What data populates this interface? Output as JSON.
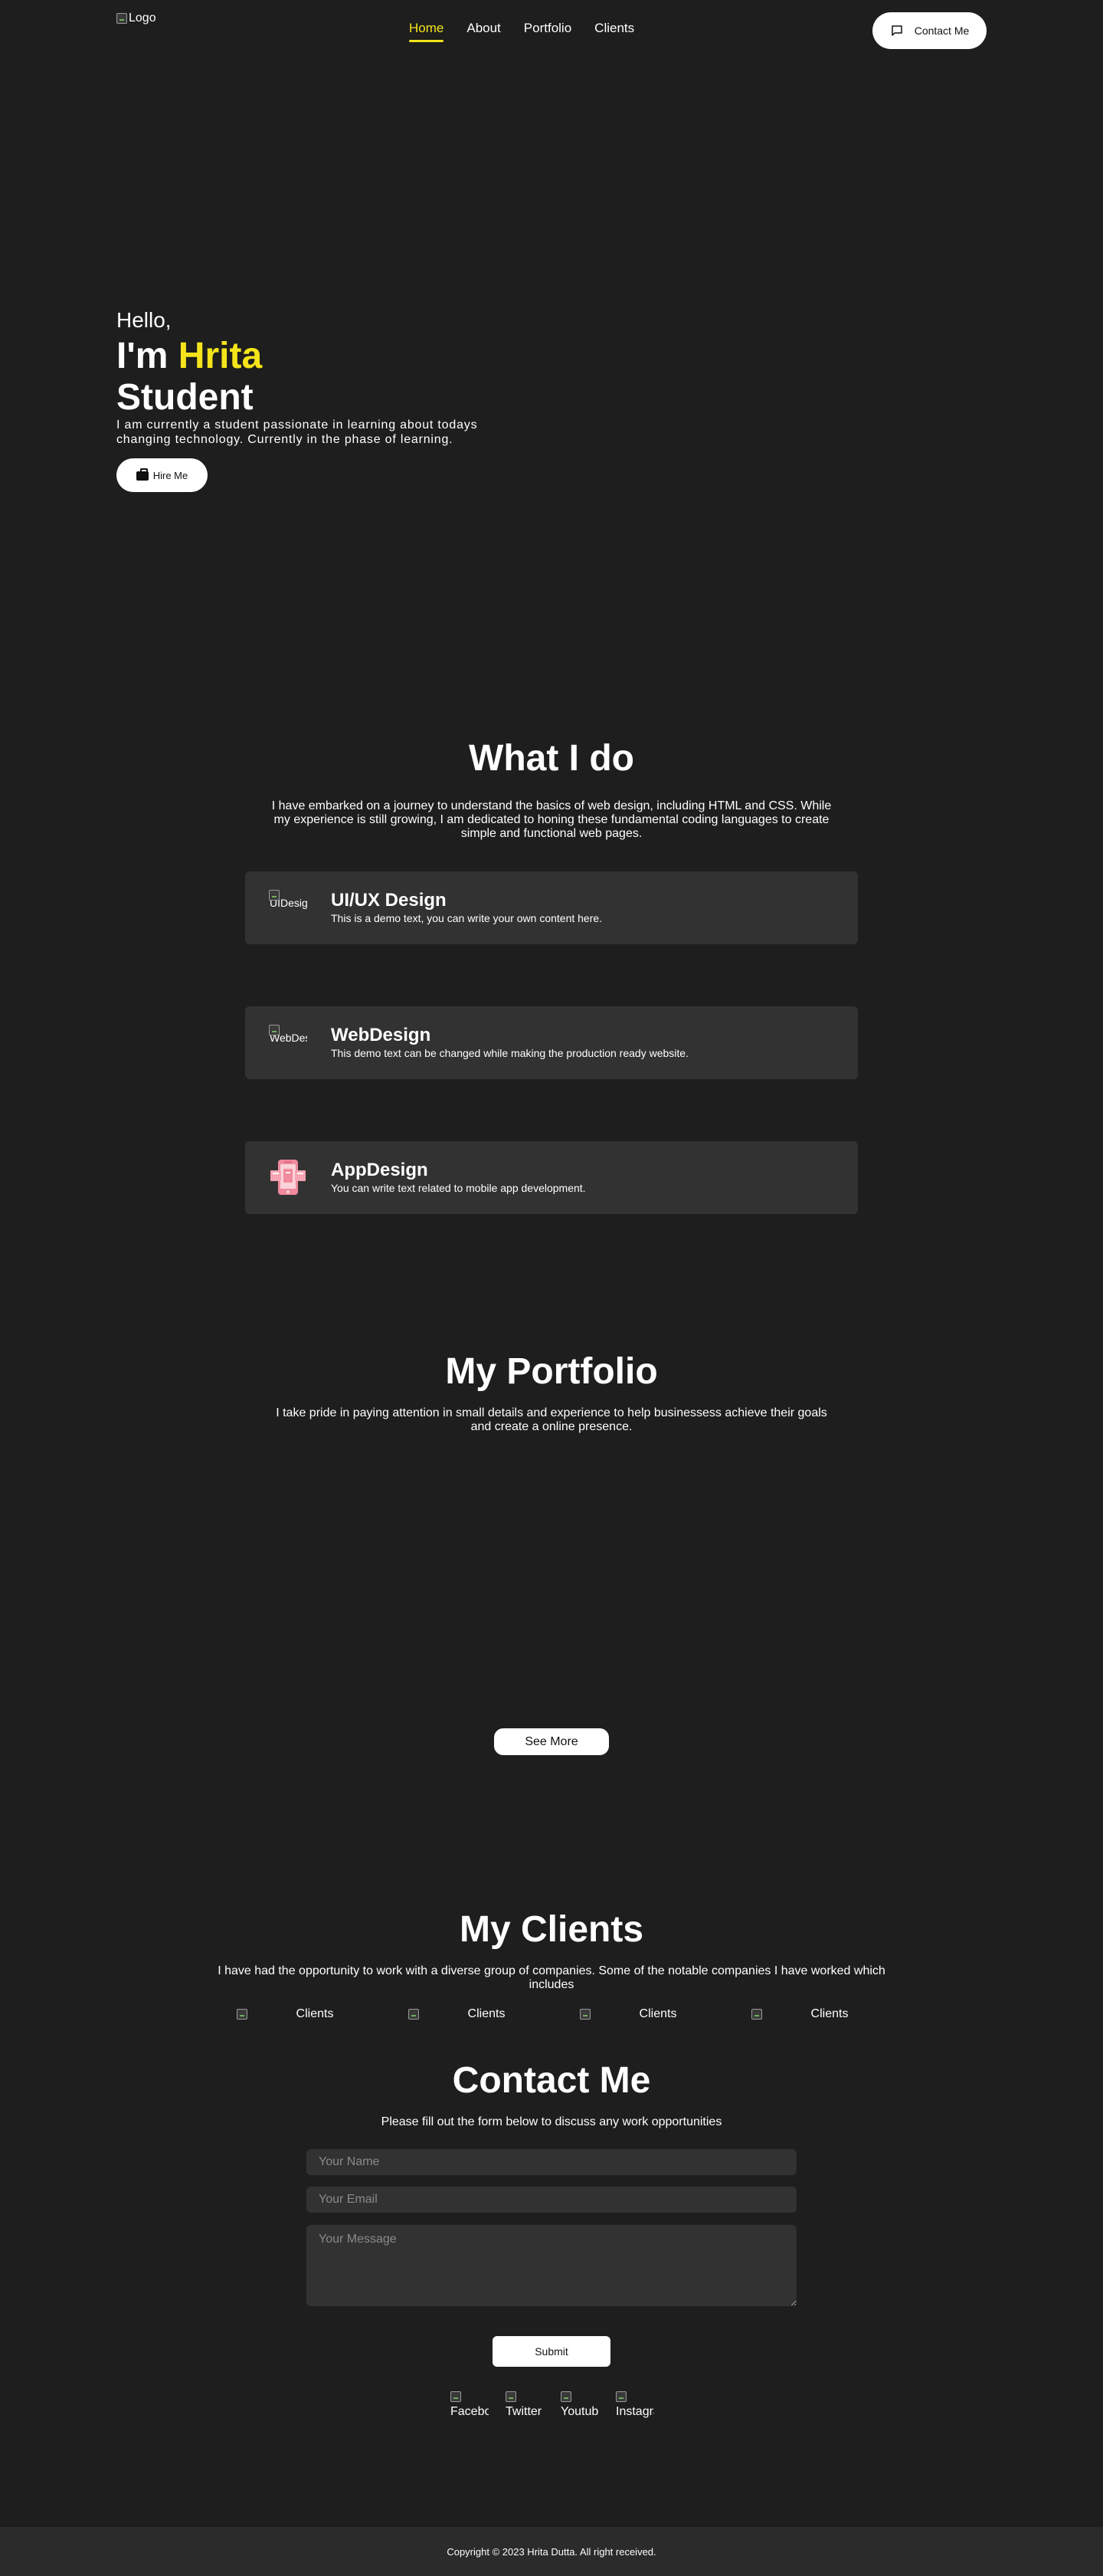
{
  "nav": {
    "logo_alt": "Logo",
    "links": [
      {
        "label": "Home",
        "active": true
      },
      {
        "label": "About",
        "active": false
      },
      {
        "label": "Portfolio",
        "active": false
      },
      {
        "label": "Clients",
        "active": false
      }
    ],
    "contact_label": "Contact Me",
    "contact_icon": "message-icon"
  },
  "hero": {
    "greeting": "Hello,",
    "name_prefix": "I'm",
    "name": "Hrita",
    "role": "Student",
    "description": "I am currently a student passionate in learning about todays changing technology. Currently in the phase of learning.",
    "hire_label": "Hire Me",
    "hire_icon": "briefcase-icon"
  },
  "services": {
    "title": "What I do",
    "description": "I have embarked on a journey to understand the basics of web design, including HTML and CSS. While my experience is still growing, I am dedicated to honing these fundamental coding languages to create simple and functional web pages.",
    "items": [
      {
        "title": "UI/UX Design",
        "text": "This is a demo text, you can write your own content here.",
        "icon_alt": "UIDesign"
      },
      {
        "title": "WebDesign",
        "text": "This demo text can be changed while making the production ready website.",
        "icon_alt": "WebDesign"
      },
      {
        "title": "AppDesign",
        "text": "You can write text related to mobile app development.",
        "icon_alt": "AppDesign"
      }
    ]
  },
  "portfolio": {
    "title": "My Portfolio",
    "description": "I take pride in paying attention in small details and experience to help businessess achieve their goals and create a online presence.",
    "see_more_label": "See More"
  },
  "clients": {
    "title": "My Clients",
    "description": "I have had the opportunity to work with a diverse group of companies. Some of the notable companies I have worked which includes",
    "logos": [
      "Clients",
      "Clients",
      "Clients",
      "Clients"
    ]
  },
  "contact": {
    "title": "Contact Me",
    "description": "Please fill out the form below to discuss any work opportunities",
    "name_placeholder": "Your Name",
    "email_placeholder": "Your Email",
    "message_placeholder": "Your Message",
    "submit_label": "Submit",
    "socials": [
      "Facebook",
      "Twitter",
      "Youtube",
      "Instagram"
    ]
  },
  "footer": {
    "copyright": "Copyright © 2023 Hrita Dutta. All right received."
  },
  "colors": {
    "background": "#1e1e1e",
    "card": "#323232",
    "accent": "#f5e41a",
    "text": "#ffffff"
  }
}
